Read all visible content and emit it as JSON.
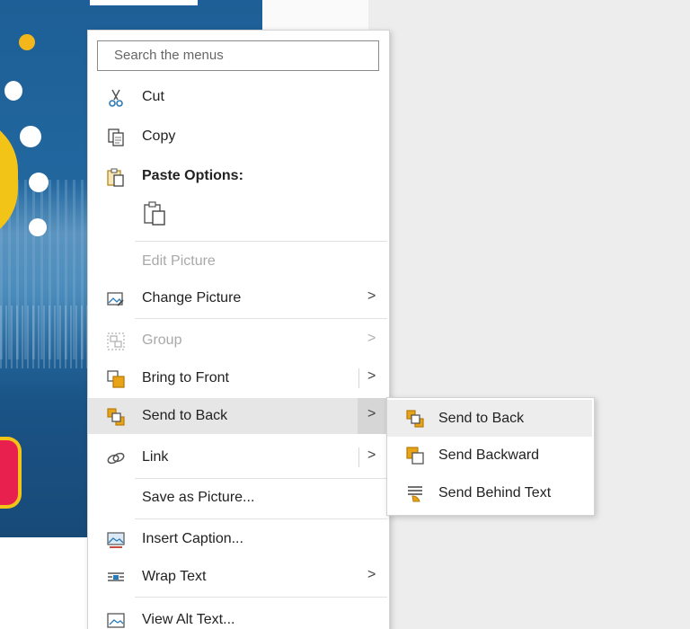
{
  "search": {
    "placeholder": "Search the menus"
  },
  "menu": {
    "cut": "Cut",
    "copy": "Copy",
    "paste_options": "Paste Options:",
    "edit_picture": "Edit Picture",
    "change_picture": "Change Picture",
    "group": "Group",
    "bring_to_front": "Bring to Front",
    "send_to_back": "Send to Back",
    "link": "Link",
    "save_as_picture": "Save as Picture...",
    "insert_caption": "Insert Caption...",
    "wrap_text": "Wrap Text",
    "view_alt_text": "View Alt Text...",
    "arrow": ">"
  },
  "submenu": {
    "send_to_back": "Send to Back",
    "send_backward": "Send Backward",
    "send_behind_text": "Send Behind Text"
  },
  "colors": {
    "accent_orange": "#e8a317",
    "slide_blue": "#1d5f96",
    "yellow": "#f3c418"
  },
  "icons": {
    "cut": "scissors-icon",
    "copy": "copy-icon",
    "paste": "paste-icon",
    "change_picture": "change-picture-icon",
    "group": "group-icon",
    "bring_to_front": "bring-to-front-icon",
    "send_to_back": "send-to-back-icon",
    "link": "link-icon",
    "insert_caption": "insert-caption-icon",
    "wrap_text": "wrap-text-icon",
    "alt_text": "alt-text-icon"
  }
}
